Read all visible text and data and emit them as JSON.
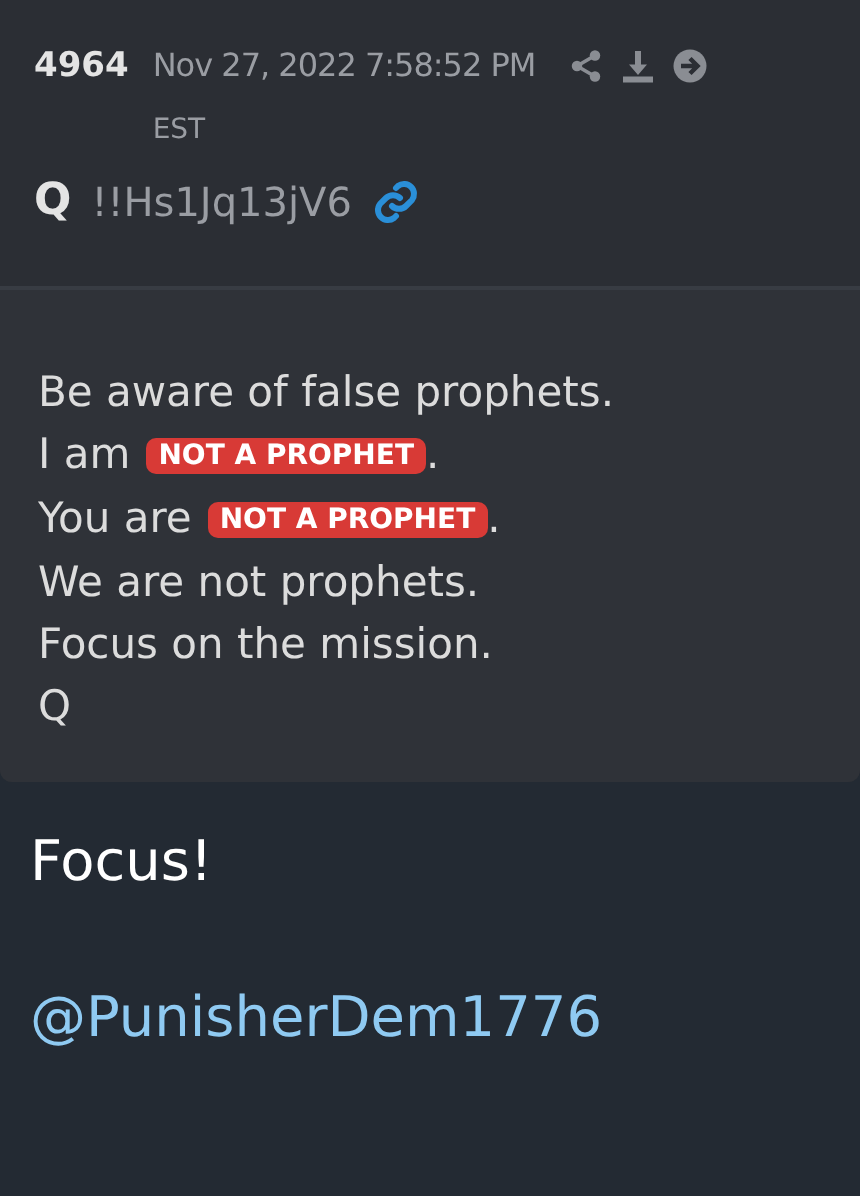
{
  "post": {
    "number": "4964",
    "date": "Nov 27, 2022 7:58:52 PM",
    "timezone": "EST",
    "author": "Q",
    "tripcode": "!!Hs1Jq13jV6",
    "lines": [
      [
        {
          "kind": "text",
          "text": "Be aware of false prophets."
        }
      ],
      [
        {
          "kind": "text",
          "text": "I am"
        },
        {
          "kind": "badge",
          "text": "NOT A PROPHET"
        },
        {
          "kind": "text",
          "text": "."
        }
      ],
      [
        {
          "kind": "text",
          "text": "You are"
        },
        {
          "kind": "badge",
          "text": "NOT A PROPHET"
        },
        {
          "kind": "text",
          "text": "."
        }
      ],
      [
        {
          "kind": "text",
          "text": "We are not prophets."
        }
      ],
      [
        {
          "kind": "text",
          "text": "Focus on the mission."
        }
      ],
      [
        {
          "kind": "text",
          "text": "Q"
        }
      ]
    ]
  },
  "caption": "Focus!",
  "handle": "@PunisherDem1776"
}
